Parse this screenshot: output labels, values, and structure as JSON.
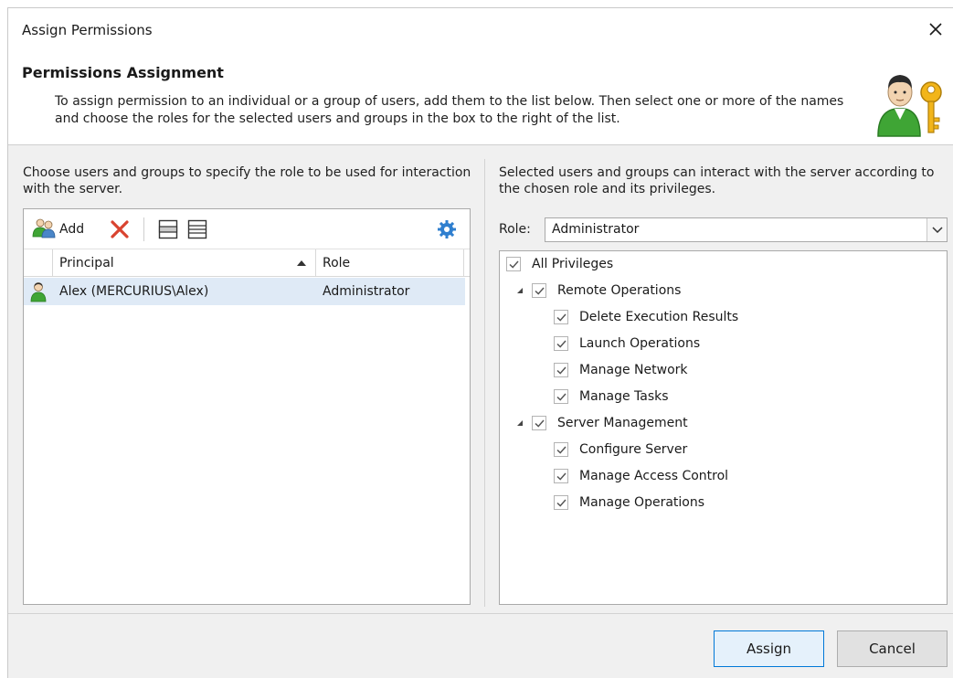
{
  "window": {
    "title": "Assign Permissions",
    "close_icon": "close-icon"
  },
  "header": {
    "title": "Permissions Assignment",
    "description": "To assign permission to an individual or a group of users, add them to the list below. Then select one or more of the names and choose the roles for the selected users and groups in the box to the right of the list.",
    "icon": "user-key-icon"
  },
  "left": {
    "description": "Choose users and groups to specify the role to be used for interaction with the server.",
    "toolbar": {
      "add_label": "Add",
      "add_icon": "add-users-icon",
      "remove_icon": "remove-icon",
      "icon_a": "layout-icon",
      "icon_b": "list-view-icon",
      "settings_icon": "gear-icon"
    },
    "columns": {
      "principal": "Principal",
      "role": "Role"
    },
    "rows": [
      {
        "principal": "Alex (MERCURIUS\\Alex)",
        "role": "Administrator",
        "icon": "user-icon"
      }
    ]
  },
  "right": {
    "description": "Selected users and groups can interact with the server according to the chosen role and its privileges.",
    "role_label": "Role:",
    "role_value": "Administrator",
    "privileges": [
      {
        "label": "All Privileges",
        "checked": true,
        "level": 0,
        "expander": false
      },
      {
        "label": "Remote Operations",
        "checked": true,
        "level": 1,
        "expander": true
      },
      {
        "label": "Delete Execution Results",
        "checked": true,
        "level": 2,
        "expander": false
      },
      {
        "label": "Launch Operations",
        "checked": true,
        "level": 2,
        "expander": false
      },
      {
        "label": "Manage Network",
        "checked": true,
        "level": 2,
        "expander": false
      },
      {
        "label": "Manage Tasks",
        "checked": true,
        "level": 2,
        "expander": false
      },
      {
        "label": "Server Management",
        "checked": true,
        "level": 1,
        "expander": true
      },
      {
        "label": "Configure Server",
        "checked": true,
        "level": 2,
        "expander": false
      },
      {
        "label": "Manage Access Control",
        "checked": true,
        "level": 2,
        "expander": false
      },
      {
        "label": "Manage Operations",
        "checked": true,
        "level": 2,
        "expander": false
      }
    ]
  },
  "footer": {
    "assign_label": "Assign",
    "cancel_label": "Cancel"
  },
  "colors": {
    "selected_row": "#dfeaf6",
    "accent": "#0078d7",
    "delete_red": "#d9432f",
    "gear_blue": "#2f7fcf",
    "avatar_green": "#3fa535"
  }
}
